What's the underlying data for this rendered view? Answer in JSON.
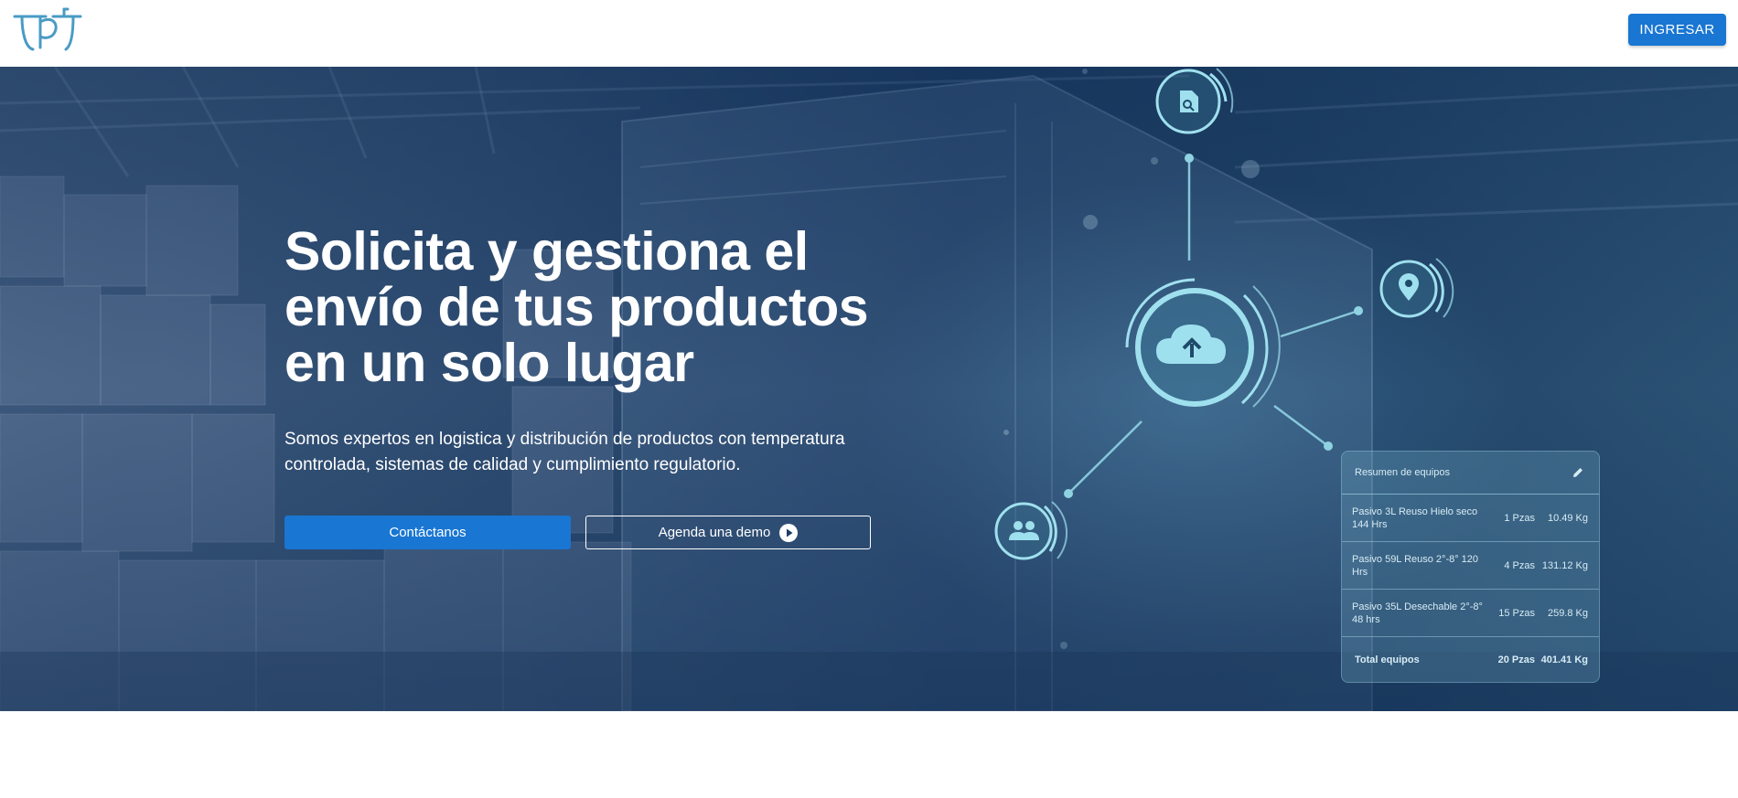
{
  "header": {
    "logo_label": "TPT",
    "login_label": "INGRESAR"
  },
  "hero": {
    "title_lines": [
      "Solicita y gestiona el",
      "envío de tus productos",
      "en un solo lugar"
    ],
    "subtitle_lines": [
      "Somos expertos en logistica y distribución de productos con temperatura",
      "controlada, sistemas de calidad y cumplimiento regulatorio."
    ],
    "contact_label": "Contáctanos",
    "demo_label": "Agenda una demo"
  },
  "summary_card": {
    "title": "Resumen de equipos",
    "rows": [
      {
        "name": "Pasivo 3L Reuso Hielo seco 144 Hrs",
        "qty": "1 Pzas",
        "weight": "10.49 Kg"
      },
      {
        "name": "Pasivo 59L Reuso 2°-8° 120 Hrs",
        "qty": "4 Pzas",
        "weight": "131.12 Kg"
      },
      {
        "name": "Pasivo 35L Desechable 2°-8° 48 hrs",
        "qty": "15 Pzas",
        "weight": "259.8 Kg"
      }
    ],
    "total": {
      "name": "Total equipos",
      "qty": "20 Pzas",
      "weight": "401.41 Kg"
    }
  },
  "icons": {
    "document": "document-search-icon",
    "cloud": "cloud-upload-icon",
    "location": "location-pin-icon",
    "users": "users-icon",
    "edit": "edit-pencil-icon",
    "play": "play-circle-icon"
  },
  "colors": {
    "primary": "#1976d2",
    "hero_dark": "#1d3c63",
    "network": "#8fd3e3"
  }
}
